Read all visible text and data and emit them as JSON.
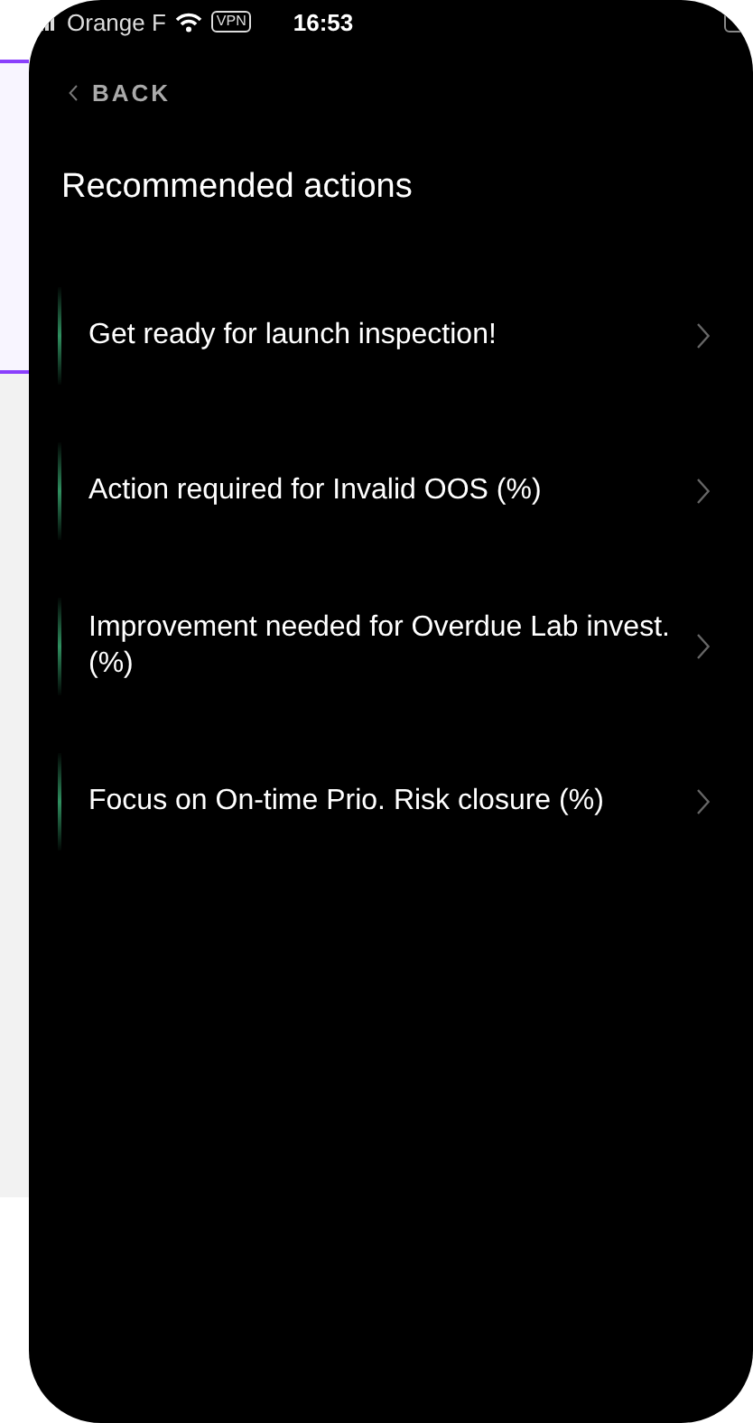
{
  "status_bar": {
    "carrier": "Orange F",
    "vpn": "VPN",
    "time": "16:53"
  },
  "back": {
    "label": "BACK"
  },
  "title": "Recommended actions",
  "actions": [
    {
      "label": "Get ready for launch inspection!"
    },
    {
      "label": "Action required for Invalid OOS (%)"
    },
    {
      "label": "Improvement needed for Overdue Lab invest. (%)"
    },
    {
      "label": "Focus on On-time Prio. Risk closure (%)"
    }
  ]
}
